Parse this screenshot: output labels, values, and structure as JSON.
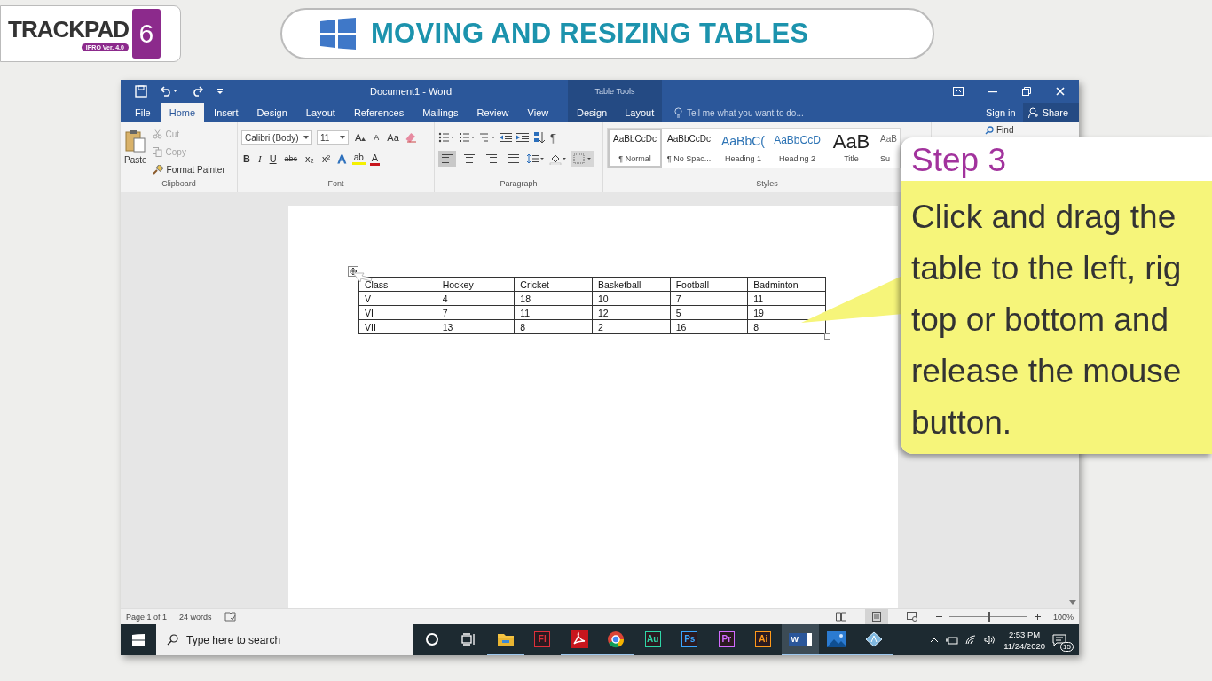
{
  "brand": {
    "name": "TRACKPAD",
    "version": "IPRO Ver. 4.0",
    "grade": "6"
  },
  "lesson_title": "MOVING AND RESIZING TABLES",
  "word": {
    "title": "Document1 - Word",
    "context_label": "Table Tools",
    "tabs": [
      {
        "label": "File",
        "selected": false,
        "kind": "file"
      },
      {
        "label": "Home",
        "selected": true,
        "kind": "main"
      },
      {
        "label": "Insert",
        "selected": false,
        "kind": "main"
      },
      {
        "label": "Design",
        "selected": false,
        "kind": "main"
      },
      {
        "label": "Layout",
        "selected": false,
        "kind": "main"
      },
      {
        "label": "References",
        "selected": false,
        "kind": "main"
      },
      {
        "label": "Mailings",
        "selected": false,
        "kind": "main"
      },
      {
        "label": "Review",
        "selected": false,
        "kind": "main"
      },
      {
        "label": "View",
        "selected": false,
        "kind": "main"
      },
      {
        "label": "Design",
        "selected": false,
        "kind": "context"
      },
      {
        "label": "Layout",
        "selected": false,
        "kind": "context"
      }
    ],
    "tell_me": {
      "placeholder": "Tell me what you want to do..."
    },
    "sign_in": "Sign in",
    "share": "Share",
    "clipboard": {
      "label": "Clipboard",
      "paste": "Paste",
      "actions": [
        {
          "kind": "cut",
          "label": "Cut",
          "disabled": true
        },
        {
          "kind": "copy",
          "label": "Copy",
          "disabled": true
        },
        {
          "kind": "painter",
          "label": "Format Painter",
          "disabled": false
        }
      ]
    },
    "font": {
      "label": "Font",
      "name": "Calibri (Body)",
      "size": "11",
      "top_tools": [
        {
          "kind": "grow",
          "label": "A"
        },
        {
          "kind": "shrink",
          "label": "A"
        },
        {
          "kind": "case",
          "label": "Aa"
        },
        {
          "kind": "clear"
        }
      ],
      "format_tools": [
        {
          "kind": "bold",
          "label": "B"
        },
        {
          "kind": "italic",
          "label": "I"
        },
        {
          "kind": "underline",
          "label": "U"
        },
        {
          "kind": "strike",
          "label": "abc"
        },
        {
          "kind": "sub",
          "label": "x₂"
        },
        {
          "kind": "sup",
          "label": "x²"
        },
        {
          "kind": "effects",
          "label": "A"
        },
        {
          "kind": "highlight",
          "label": "ab"
        },
        {
          "kind": "color",
          "label": "A"
        }
      ]
    },
    "paragraph": {
      "label": "Paragraph",
      "marks": "¶",
      "align": [
        {
          "kind": "left",
          "selected": true
        },
        {
          "kind": "center",
          "selected": false
        },
        {
          "kind": "right",
          "selected": false
        },
        {
          "kind": "justify",
          "selected": false
        }
      ]
    },
    "styles": {
      "label": "Styles",
      "items": [
        {
          "kind": "normal",
          "preview": "AaBbCcDc",
          "name": "¶ Normal",
          "selected": true
        },
        {
          "kind": "nospace",
          "preview": "AaBbCcDc",
          "name": "¶ No Spac...",
          "selected": false
        },
        {
          "kind": "heading1",
          "preview": "AaBbC(",
          "name": "Heading 1",
          "selected": false
        },
        {
          "kind": "heading2",
          "preview": "AaBbCcD",
          "name": "Heading 2",
          "selected": false
        },
        {
          "kind": "title",
          "preview": "AaB",
          "name": "Title",
          "selected": false
        },
        {
          "kind": "subtitle",
          "preview": "AaB",
          "name": "Su",
          "selected": false
        }
      ]
    },
    "find": "Find",
    "table": [
      [
        "Class",
        "Hockey",
        "Cricket",
        "Basketball",
        "Football",
        "Badminton"
      ],
      [
        "V",
        "4",
        "18",
        "10",
        "7",
        "11"
      ],
      [
        "VI",
        "7",
        "11",
        "12",
        "5",
        "19"
      ],
      [
        "VII",
        "13",
        "8",
        "2",
        "16",
        "8"
      ]
    ],
    "status": {
      "page": "Page 1 of 1",
      "words": "24 words",
      "zoom": "100%",
      "zoom_slider": {
        "level": 0.5
      },
      "views": [
        {
          "kind": "read",
          "selected": false
        },
        {
          "kind": "print",
          "selected": true
        },
        {
          "kind": "web",
          "selected": false
        }
      ]
    }
  },
  "taskbar": {
    "search": {
      "placeholder": "Type here to search"
    },
    "apps": [
      {
        "kind": "cortana",
        "running": false
      },
      {
        "kind": "taskview",
        "running": false
      },
      {
        "kind": "explorer",
        "running": true
      },
      {
        "kind": "tile",
        "label": "Fl",
        "color": "#e0303a",
        "running": false
      },
      {
        "kind": "acrobat",
        "running": true
      },
      {
        "kind": "chrome",
        "running": true
      },
      {
        "kind": "tile",
        "label": "Au",
        "color": "#2fd6a8",
        "running": false
      },
      {
        "kind": "tile",
        "label": "Ps",
        "color": "#3aa6ff",
        "running": false
      },
      {
        "kind": "tile",
        "label": "Pr",
        "color": "#d26bff",
        "running": false
      },
      {
        "kind": "tile",
        "label": "Ai",
        "color": "#ff9a1a",
        "running": false
      },
      {
        "kind": "word",
        "label": "W",
        "running": true,
        "selected": true
      },
      {
        "kind": "photos",
        "running": true
      },
      {
        "kind": "paint",
        "running": true
      }
    ],
    "time": "2:53 PM",
    "date": "11/24/2020",
    "notifications": "15"
  },
  "callout": {
    "heading": "Step 3",
    "lines": [
      "Click and drag the",
      "table to the left, rig",
      "top or bottom and",
      "release the mouse",
      "button."
    ]
  }
}
